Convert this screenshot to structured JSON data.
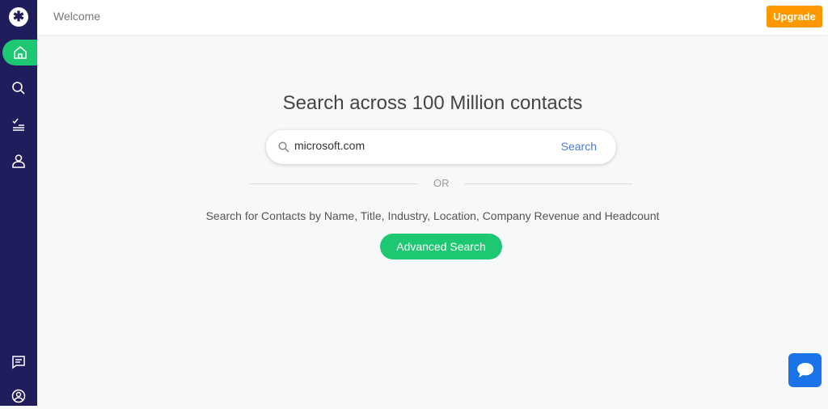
{
  "header": {
    "title": "Welcome",
    "upgrade_label": "Upgrade"
  },
  "sidebar": {
    "logo": "✱",
    "items": [
      {
        "name": "home-icon",
        "active": true
      },
      {
        "name": "search-icon"
      },
      {
        "name": "tasks-icon"
      },
      {
        "name": "user-icon"
      },
      {
        "name": "chat-icon"
      },
      {
        "name": "account-icon"
      }
    ]
  },
  "main": {
    "title": "Search across 100 Million contacts",
    "search_value": "microsoft.com",
    "search_label": "Search",
    "or_label": "OR",
    "description": "Search for Contacts by Name, Title, Industry, Location, Company Revenue and Headcount",
    "advanced_label": "Advanced Search"
  },
  "colors": {
    "sidebar": "#1f1d5b",
    "accent": "#1ec872",
    "upgrade": "#ff9800",
    "link": "#4a7bd8",
    "chat": "#1a73e8"
  }
}
